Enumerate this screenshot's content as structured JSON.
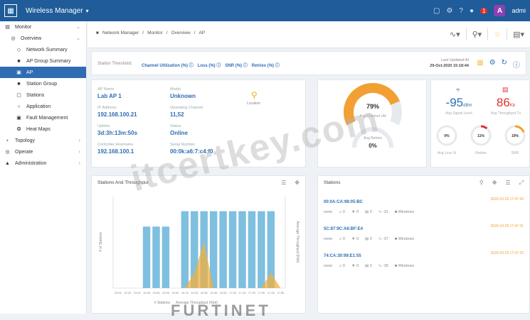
{
  "header": {
    "app_title": "Wireless Manager",
    "admin_initial": "A",
    "admin_label": "admi",
    "alert_count": "1"
  },
  "sidebar": {
    "items": [
      {
        "label": "Monitor",
        "level": 0
      },
      {
        "label": "Overview",
        "level": 1
      },
      {
        "label": "Network Summary",
        "level": 2
      },
      {
        "label": "AP Group Summary",
        "level": 2
      },
      {
        "label": "AP",
        "level": 2,
        "active": true
      },
      {
        "label": "Station Group",
        "level": 2
      },
      {
        "label": "Stations",
        "level": 2
      },
      {
        "label": "Application",
        "level": 2
      },
      {
        "label": "Fault Management",
        "level": 2
      },
      {
        "label": "Heat Maps",
        "level": 2
      },
      {
        "label": "Topology",
        "level": 0
      },
      {
        "label": "Operate",
        "level": 0
      },
      {
        "label": "Administration",
        "level": 0
      }
    ]
  },
  "breadcrumb": [
    "Network Manager",
    "Monitor",
    "Overview",
    "AP"
  ],
  "threshold": {
    "label": "Station Threshold:",
    "items": [
      "Channel Utilization (%)",
      "Loss (%)",
      "SNR (%)",
      "Retries (%)"
    ],
    "last_updated_label": "Last Updated At",
    "last_updated_value": "29-Oct-2020 15:18:44"
  },
  "ap_info": {
    "fields": [
      {
        "label": "AP Name",
        "value": "Lab AP 1"
      },
      {
        "label": "Model",
        "value": "Unknown"
      },
      {
        "label": "IP Address",
        "value": "192.168.100.21"
      },
      {
        "label": "Operating Channel",
        "value": "11,52"
      },
      {
        "label": "Uptime",
        "value": "3d:3h:13m:50s"
      },
      {
        "label": "Status",
        "value": "Online"
      },
      {
        "label": "Controller Hostname",
        "value": "192.168.100.1"
      },
      {
        "label": "Serial Number",
        "value": "00:0k:a6:7:c4:f0"
      }
    ],
    "location_label": "Location"
  },
  "gauges": {
    "channel_util_value": "79%",
    "channel_util_label": "Avg Channel Util",
    "channel_util_fraction": 0.79,
    "retries_label": "Avg Retries",
    "retries_value": "0%",
    "retries_fraction": 0
  },
  "metrics": {
    "signal_value": "-95",
    "signal_unit": "dBm",
    "signal_label": "Avg Signal Level",
    "throughput_value": "86",
    "throughput_unit": "Kb",
    "throughput_label": "Avg Throughput Tx",
    "loss_value": "0%",
    "loss_label": "Avg Loss %",
    "retries_value": "11%",
    "retries_label": "Retries",
    "snr_value": "19%",
    "snr_label": "SNR"
  },
  "chart_card": {
    "title": "Stations And Throughput"
  },
  "stations_card": {
    "title": "Stations",
    "rows": [
      {
        "name": "00:0A:CA:98:05:BC",
        "time": "2020-10-29 17:47:30",
        "stats": [
          "none",
          "0",
          "0",
          "0",
          "-31",
          "Windows"
        ]
      },
      {
        "name": "5C:87:9C:A6:BF:E4",
        "time": "2020-10-29 17:47:31",
        "stats": [
          "none",
          "0",
          "0",
          "0",
          "-37",
          "Windows"
        ]
      },
      {
        "name": "74:CA:30:99:E1:55",
        "time": "2020-10-29 17:47:32",
        "stats": [
          "none",
          "0",
          "0",
          "0",
          "-35",
          "Windows"
        ]
      }
    ]
  },
  "watermark": "itcertkey.com",
  "brand_watermark": "FURTINET",
  "chart_data": {
    "type": "bar",
    "title": "Stations And Throughput",
    "categories": [
      "15:06",
      "15:16",
      "15:26",
      "15:36",
      "15:46",
      "15:56",
      "16:06",
      "16:16",
      "16:26",
      "16:36",
      "16:46",
      "16:56",
      "17:06",
      "17:16",
      "17:26",
      "17:36",
      "17:46",
      "17:56"
    ],
    "series": [
      {
        "name": "# Stations",
        "kind": "bar",
        "values": [
          0,
          0,
          0,
          4,
          4,
          4,
          0,
          5,
          5,
          5,
          5,
          5,
          5,
          5,
          5,
          5,
          5,
          0
        ]
      },
      {
        "name": "Average Throughput (Kbit)",
        "kind": "area",
        "values": [
          0,
          0,
          0,
          0,
          0,
          0,
          0,
          0,
          1,
          3,
          0,
          0,
          0,
          0,
          0,
          0,
          1,
          0
        ]
      }
    ],
    "ylabel": "# of Stations",
    "y2label": "Average Throughput (Kbit)",
    "ylim": [
      0,
      6
    ],
    "legend": "bottom",
    "colors": {
      "bar": "#7fbfe0",
      "area": "#f0b040"
    }
  }
}
